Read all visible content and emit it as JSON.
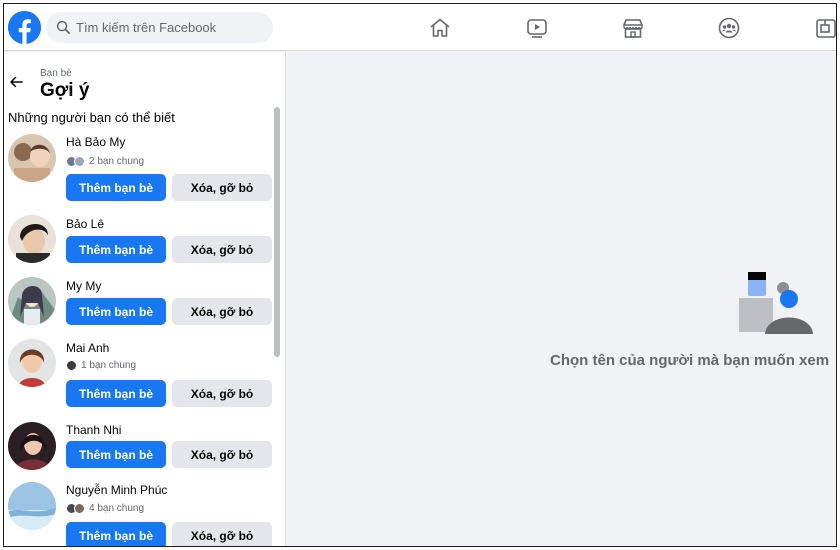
{
  "search": {
    "placeholder": "Tìm kiếm trên Facebook"
  },
  "nav": {
    "items": [
      {
        "icon": "home-icon"
      },
      {
        "icon": "watch-icon"
      },
      {
        "icon": "marketplace-icon"
      },
      {
        "icon": "groups-icon"
      },
      {
        "icon": "gaming-icon"
      }
    ]
  },
  "sidebar": {
    "breadcrumb": "Bạn bè",
    "title": "Gợi ý",
    "section_title": "Những người bạn có thể biết",
    "people": [
      {
        "name": "Hà Bảo My",
        "mutual": "2 bạn chung",
        "add_label": "Thêm bạn bè",
        "remove_label": "Xóa, gỡ bỏ"
      },
      {
        "name": "Bảo Lê",
        "mutual": "",
        "add_label": "Thêm bạn bè",
        "remove_label": "Xóa, gỡ bỏ"
      },
      {
        "name": "My My",
        "mutual": "",
        "add_label": "Thêm bạn bè",
        "remove_label": "Xóa, gỡ bỏ"
      },
      {
        "name": "Mai Anh",
        "mutual": "1 bạn chung",
        "add_label": "Thêm bạn bè",
        "remove_label": "Xóa, gỡ bỏ"
      },
      {
        "name": "Thanh Nhi",
        "mutual": "",
        "add_label": "Thêm bạn bè",
        "remove_label": "Xóa, gỡ bỏ"
      },
      {
        "name": "Nguyễn Minh Phúc",
        "mutual": "4 bạn chung",
        "add_label": "Thêm bạn bè",
        "remove_label": "Xóa, gỡ bỏ"
      }
    ]
  },
  "main": {
    "empty_text": "Chọn tên của người mà bạn muốn xem"
  },
  "colors": {
    "brand": "#1877f2",
    "secondary_button": "#e4e6eb",
    "background": "#f0f2f5",
    "muted_text": "#65676b"
  }
}
